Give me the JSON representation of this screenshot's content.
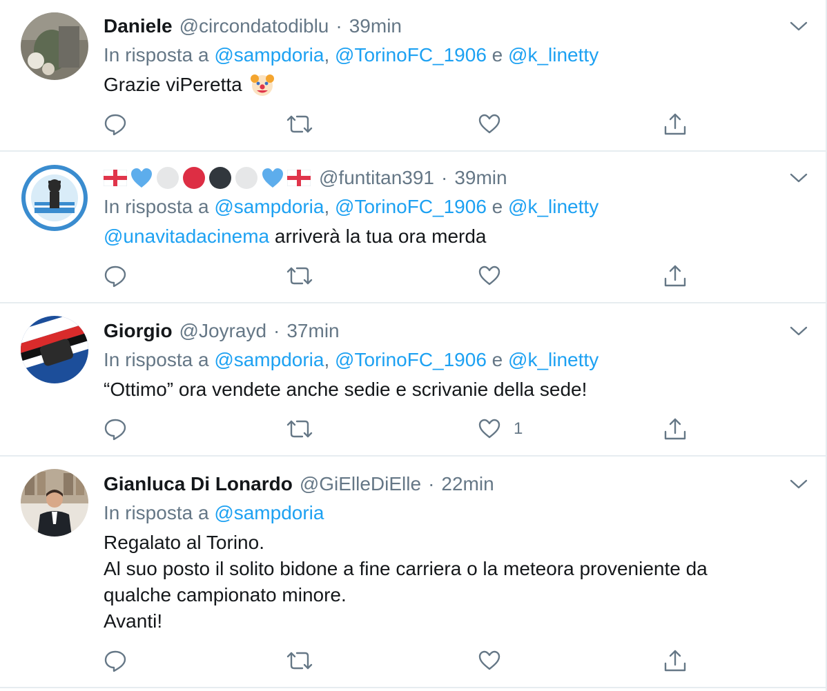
{
  "tweets": [
    {
      "name": "Daniele",
      "handle": "@circondatodiblu",
      "separator": "·",
      "time": "39min",
      "reply_prefix": "In risposta a",
      "reply_handles": [
        "@sampdoria",
        "@TorinoFC_1906",
        "@k_linetty"
      ],
      "reply_joiners": [
        ", ",
        " e "
      ],
      "text": "Grazie viPeretta",
      "text_emoji": "clown-face",
      "likes": ""
    },
    {
      "name_emojis": [
        "england-flag",
        "blue-heart",
        "white-circle",
        "red-circle",
        "black-circle",
        "white-circle",
        "blue-heart",
        "england-flag"
      ],
      "handle": "@funtitan391",
      "separator": "·",
      "time": "39min",
      "reply_prefix": "In risposta a",
      "reply_handles": [
        "@sampdoria",
        "@TorinoFC_1906",
        "@k_linetty"
      ],
      "reply_joiners": [
        ", ",
        " e "
      ],
      "text_mention": "@unavitadacinema",
      "text": "arriverà la tua ora merda",
      "likes": ""
    },
    {
      "name": "Giorgio",
      "handle": "@Joyrayd",
      "separator": "·",
      "time": "37min",
      "reply_prefix": "In risposta a",
      "reply_handles": [
        "@sampdoria",
        "@TorinoFC_1906",
        "@k_linetty"
      ],
      "reply_joiners": [
        ", ",
        " e "
      ],
      "text": "“Ottimo” ora vendete anche sedie e scrivanie della sede!",
      "likes": "1"
    },
    {
      "name": "Gianluca Di Lonardo",
      "handle": "@GiElleDiElle",
      "separator": "·",
      "time": "22min",
      "reply_prefix": "In risposta a",
      "reply_handles": [
        "@sampdoria"
      ],
      "text_lines": [
        "Regalato al Torino.",
        "Al suo posto il solito bidone a fine carriera o la meteora proveniente da",
        "qualche campionato minore.",
        "Avanti!"
      ],
      "likes": ""
    }
  ],
  "colors": {
    "link": "#1da1f2",
    "secondary": "#657786",
    "divider": "#e6ecf0"
  },
  "icons": [
    "reply-icon",
    "retweet-icon",
    "like-icon",
    "share-icon",
    "chevron-down-icon"
  ]
}
